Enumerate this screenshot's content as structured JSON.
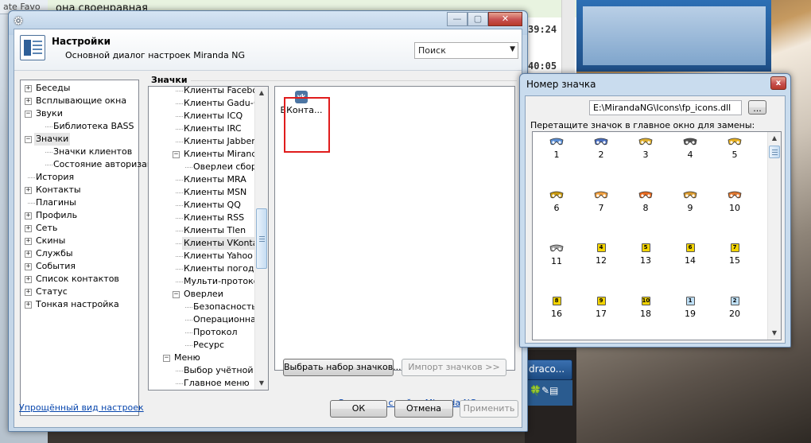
{
  "background": {
    "tab_text": "ate  Favo",
    "chat_line": "она своенравная",
    "times": [
      "39:24",
      "40:05"
    ],
    "taskbar_label": "draco...",
    "tray_glyphs": "🍀✎▤"
  },
  "settings": {
    "title": "Настройки",
    "subtitle": "Основной диалог настроек Miranda NG",
    "search_placeholder": "Поиск",
    "left_tree": [
      {
        "label": "Беседы",
        "level": 0,
        "exp": "+"
      },
      {
        "label": "Всплывающие окна",
        "level": 0,
        "exp": "+"
      },
      {
        "label": "Звуки",
        "level": 0,
        "exp": "-"
      },
      {
        "label": "Библиотека BASS",
        "level": 1,
        "exp": ""
      },
      {
        "label": "Значки",
        "level": 0,
        "exp": "-",
        "selected": true
      },
      {
        "label": "Значки клиентов",
        "level": 1,
        "exp": ""
      },
      {
        "label": "Состояние авторизации",
        "level": 1,
        "exp": ""
      },
      {
        "label": "История",
        "level": 0,
        "exp": ""
      },
      {
        "label": "Контакты",
        "level": 0,
        "exp": "+"
      },
      {
        "label": "Плагины",
        "level": 0,
        "exp": ""
      },
      {
        "label": "Профиль",
        "level": 0,
        "exp": "+"
      },
      {
        "label": "Сеть",
        "level": 0,
        "exp": "+"
      },
      {
        "label": "Скины",
        "level": 0,
        "exp": "+"
      },
      {
        "label": "Службы",
        "level": 0,
        "exp": "+"
      },
      {
        "label": "События",
        "level": 0,
        "exp": "+"
      },
      {
        "label": "Список контактов",
        "level": 0,
        "exp": "+"
      },
      {
        "label": "Статус",
        "level": 0,
        "exp": "+"
      },
      {
        "label": "Тонкая настройка",
        "level": 0,
        "exp": "+"
      }
    ],
    "simple_view_link": "Упрощённый вид настроек",
    "group_label": "Значки",
    "icon_tree": [
      {
        "label": "Клиенты Facebook",
        "level": 1,
        "exp": ""
      },
      {
        "label": "Клиенты Gadu-Gadu",
        "level": 1,
        "exp": ""
      },
      {
        "label": "Клиенты ICQ",
        "level": 1,
        "exp": ""
      },
      {
        "label": "Клиенты IRC",
        "level": 1,
        "exp": ""
      },
      {
        "label": "Клиенты Jabber",
        "level": 1,
        "exp": ""
      },
      {
        "label": "Клиенты Miranda",
        "level": 1,
        "exp": "-"
      },
      {
        "label": "Оверлеи сборок",
        "level": 2,
        "exp": ""
      },
      {
        "label": "Клиенты MRA",
        "level": 1,
        "exp": ""
      },
      {
        "label": "Клиенты MSN",
        "level": 1,
        "exp": ""
      },
      {
        "label": "Клиенты QQ",
        "level": 1,
        "exp": ""
      },
      {
        "label": "Клиенты RSS",
        "level": 1,
        "exp": ""
      },
      {
        "label": "Клиенты Tlen",
        "level": 1,
        "exp": ""
      },
      {
        "label": "Клиенты VKontakte",
        "level": 1,
        "exp": "",
        "selected": true
      },
      {
        "label": "Клиенты Yahoo",
        "level": 1,
        "exp": ""
      },
      {
        "label": "Клиенты погоды",
        "level": 1,
        "exp": ""
      },
      {
        "label": "Мульти-протокольные",
        "level": 1,
        "exp": ""
      },
      {
        "label": "Оверлеи",
        "level": 1,
        "exp": "-"
      },
      {
        "label": "Безопасность",
        "level": 2,
        "exp": ""
      },
      {
        "label": "Операционная",
        "level": 2,
        "exp": ""
      },
      {
        "label": "Протокол",
        "level": 2,
        "exp": ""
      },
      {
        "label": "Ресурс",
        "level": 2,
        "exp": ""
      },
      {
        "label": "Меню",
        "level": 0,
        "exp": "-"
      },
      {
        "label": "Выбор учётной записи",
        "level": 1,
        "exp": ""
      },
      {
        "label": "Главное меню",
        "level": 1,
        "exp": ""
      }
    ],
    "vk_item": {
      "icon_text": "vk",
      "label": "ВКонта..."
    },
    "choose_set_button": "Выбрать набор значков...",
    "import_button": "Импорт значков >>",
    "download_link": "Загрузить с сайта Miranda NG",
    "ok_button": "ОК",
    "cancel_button": "Отмена",
    "apply_button": "Применить"
  },
  "icon_dialog": {
    "title": "Номер значка",
    "close_glyph": "x",
    "path": "E:\\MirandaNG\\Icons\\fp_icons.dll",
    "browse_label": "...",
    "drag_hint": "Перетащите значок в главное окно для замены:",
    "icons": [
      {
        "num": "1",
        "kind": "glasses",
        "color": "#5b8fd6"
      },
      {
        "num": "2",
        "kind": "glasses",
        "color": "#4a6fc0"
      },
      {
        "num": "3",
        "kind": "glasses",
        "color": "#e0b030"
      },
      {
        "num": "4",
        "kind": "glasses",
        "color": "#555555"
      },
      {
        "num": "5",
        "kind": "glasses",
        "color": "#e8b020"
      },
      {
        "num": "6",
        "kind": "glasses",
        "color": "#c99a10"
      },
      {
        "num": "7",
        "kind": "glasses",
        "color": "#f0a040"
      },
      {
        "num": "8",
        "kind": "glasses",
        "color": "#e86a20"
      },
      {
        "num": "9",
        "kind": "glasses",
        "color": "#d89a30"
      },
      {
        "num": "10",
        "kind": "glasses",
        "color": "#e07830"
      },
      {
        "num": "11",
        "kind": "glasses",
        "color": "#a0a0a0"
      },
      {
        "num": "12",
        "kind": "badge",
        "glyph": "4",
        "color": "#f3d400"
      },
      {
        "num": "13",
        "kind": "badge",
        "glyph": "5",
        "color": "#f3d400"
      },
      {
        "num": "14",
        "kind": "badge",
        "glyph": "6",
        "color": "#f3d400"
      },
      {
        "num": "15",
        "kind": "badge",
        "glyph": "7",
        "color": "#f3d400"
      },
      {
        "num": "16",
        "kind": "badge",
        "glyph": "8",
        "color": "#f3d400"
      },
      {
        "num": "17",
        "kind": "badge",
        "glyph": "9",
        "color": "#f3d400"
      },
      {
        "num": "18",
        "kind": "badge",
        "glyph": "10",
        "color": "#f3d400"
      },
      {
        "num": "19",
        "kind": "badge",
        "glyph": "1",
        "color": "#bfe0f7"
      },
      {
        "num": "20",
        "kind": "badge",
        "glyph": "2",
        "color": "#bfe0f7"
      }
    ]
  }
}
